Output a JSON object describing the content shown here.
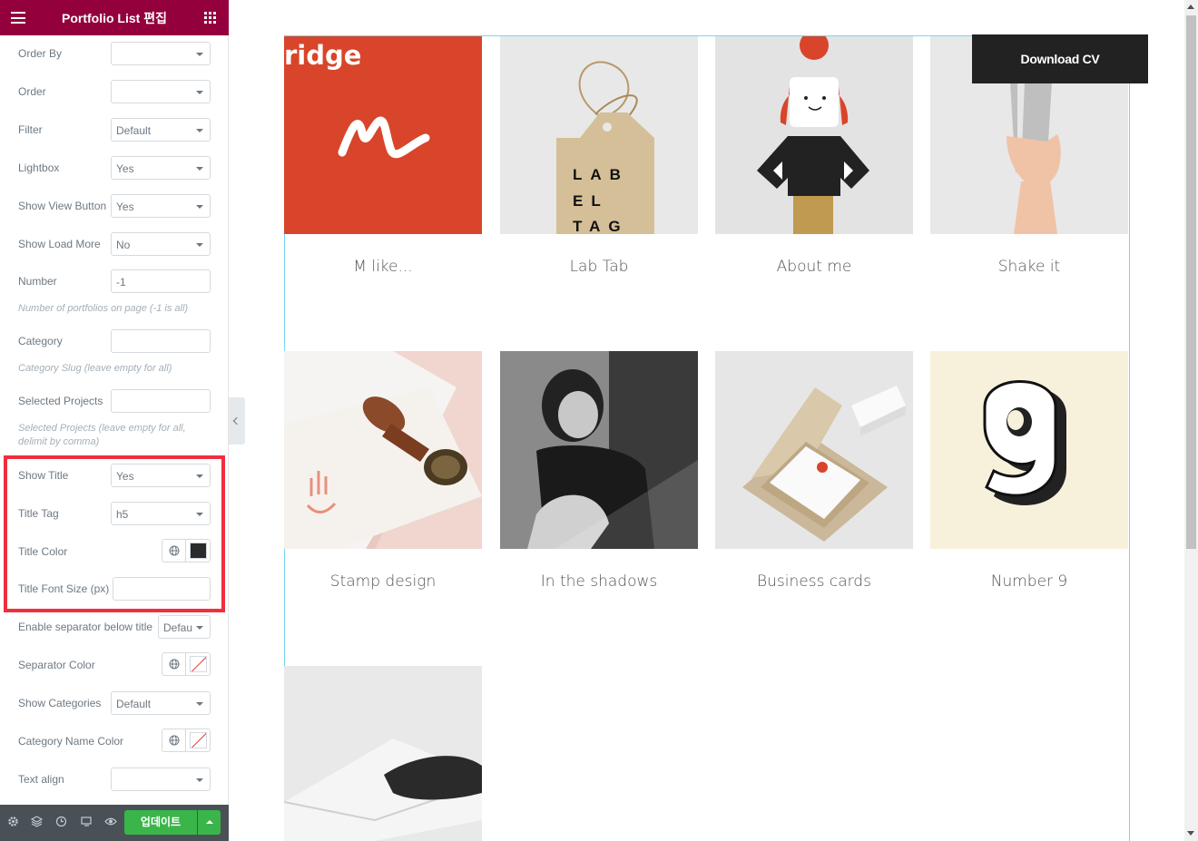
{
  "panel": {
    "title": "Portfolio List 편집",
    "controls": {
      "order_by": {
        "label": "Order By",
        "value": ""
      },
      "order": {
        "label": "Order",
        "value": ""
      },
      "filter": {
        "label": "Filter",
        "value": "Default"
      },
      "lightbox": {
        "label": "Lightbox",
        "value": "Yes"
      },
      "show_view_button": {
        "label": "Show View Button",
        "value": "Yes"
      },
      "show_load_more": {
        "label": "Show Load More",
        "value": "No"
      },
      "number": {
        "label": "Number",
        "value": "-1",
        "hint": "Number of portfolios on page (-1 is all)"
      },
      "category": {
        "label": "Category",
        "value": "",
        "hint": "Category Slug (leave empty for all)"
      },
      "selected_projects": {
        "label": "Selected Projects",
        "value": "",
        "hint": "Selected Projects (leave empty for all, delimit by comma)"
      },
      "show_title": {
        "label": "Show Title",
        "value": "Yes"
      },
      "title_tag": {
        "label": "Title Tag",
        "value": "h5"
      },
      "title_color": {
        "label": "Title Color",
        "color": "#2b2b2b"
      },
      "title_font_size": {
        "label": "Title Font Size (px)",
        "value": ""
      },
      "enable_separator": {
        "label": "Enable separator below title",
        "value": "Defau"
      },
      "separator_color": {
        "label": "Separator Color"
      },
      "show_categories": {
        "label": "Show Categories",
        "value": "Default"
      },
      "category_name_color": {
        "label": "Category Name Color"
      },
      "text_align": {
        "label": "Text align",
        "value": ""
      }
    },
    "footer": {
      "update_label": "업데이트"
    }
  },
  "preview": {
    "brand_text": "ridge",
    "download_cv": "Download CV",
    "portfolio_items": [
      {
        "title": "M like..."
      },
      {
        "title": "Lab Tab"
      },
      {
        "title": "About me"
      },
      {
        "title": "Shake it"
      },
      {
        "title": "Stamp design"
      },
      {
        "title": "In the shadows"
      },
      {
        "title": "Business cards"
      },
      {
        "title": "Number 9"
      },
      {
        "title": ""
      }
    ],
    "label_tag_text": [
      "LAB",
      "EL",
      "TAG"
    ]
  },
  "colors": {
    "header": "#93003c",
    "update_button": "#39b54a",
    "highlight": "#ef2f3e",
    "accent_orange": "#d8452a"
  }
}
